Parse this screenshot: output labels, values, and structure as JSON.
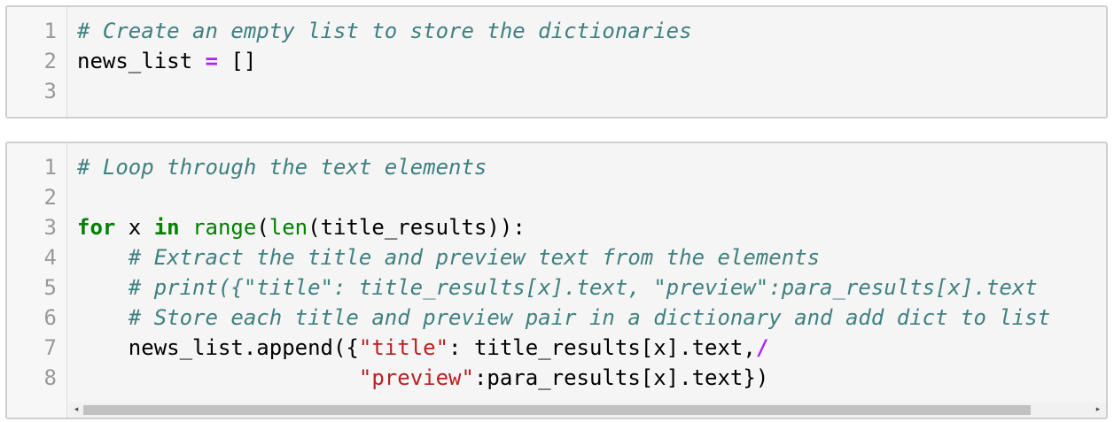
{
  "cell1": {
    "line_numbers": [
      "1",
      "2",
      "3"
    ],
    "lines": [
      [
        {
          "t": "# Create an empty list to store the dictionaries",
          "c": "cm"
        }
      ],
      [
        {
          "t": "news_list ",
          "c": ""
        },
        {
          "t": "=",
          "c": "op"
        },
        {
          "t": " []",
          "c": ""
        }
      ],
      []
    ]
  },
  "cell2": {
    "line_numbers": [
      "1",
      "2",
      "3",
      "4",
      "5",
      "6",
      "7",
      "8"
    ],
    "lines": [
      [
        {
          "t": "# Loop through the text elements",
          "c": "cm"
        }
      ],
      [],
      [
        {
          "t": "for",
          "c": "kw"
        },
        {
          "t": " x ",
          "c": ""
        },
        {
          "t": "in",
          "c": "kw"
        },
        {
          "t": " ",
          "c": ""
        },
        {
          "t": "range",
          "c": "bi"
        },
        {
          "t": "(",
          "c": ""
        },
        {
          "t": "len",
          "c": "bi"
        },
        {
          "t": "(title_results)):",
          "c": ""
        }
      ],
      [
        {
          "t": "    ",
          "c": ""
        },
        {
          "t": "# Extract the title and preview text from the elements",
          "c": "cm"
        }
      ],
      [
        {
          "t": "    ",
          "c": ""
        },
        {
          "t": "# print({\"title\": title_results[x].text, \"preview\":para_results[x].text",
          "c": "cm"
        }
      ],
      [
        {
          "t": "    ",
          "c": ""
        },
        {
          "t": "# Store each title and preview pair in a dictionary and add dict to list",
          "c": "cm"
        }
      ],
      [
        {
          "t": "    news_list.append({",
          "c": ""
        },
        {
          "t": "\"title\"",
          "c": "st"
        },
        {
          "t": ": title_results[x].text,",
          "c": ""
        },
        {
          "t": "/",
          "c": "op"
        }
      ],
      [
        {
          "t": "                      ",
          "c": ""
        },
        {
          "t": "\"preview\"",
          "c": "st"
        },
        {
          "t": ":para_results[x].text})",
          "c": ""
        }
      ]
    ]
  },
  "scrollbar": {
    "left_arrow": "◂",
    "right_arrow": "▸",
    "thumb_fraction": 0.94
  },
  "colors": {
    "comment": "#408080",
    "keyword": "#008000",
    "operator": "#aa22ff",
    "string": "#ba2121",
    "line_number": "#999999",
    "cell_background": "#f5f5f5"
  }
}
